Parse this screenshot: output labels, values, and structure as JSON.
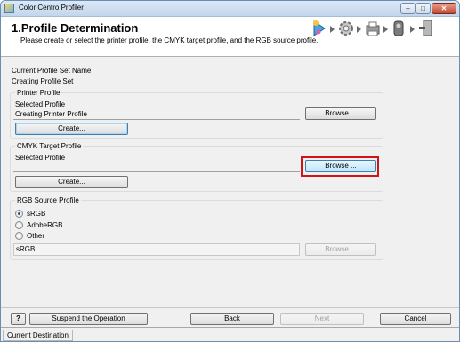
{
  "window": {
    "title": "Color Centro Profiler",
    "min_glyph": "–",
    "max_glyph": "□",
    "close_glyph": "✕"
  },
  "header": {
    "title": "1.Profile Determination",
    "description": "Please create or select the printer profile, the CMYK target profile, and the RGB source profile.",
    "steps": [
      "profile-step-icon",
      "gear-step-icon",
      "print-step-icon",
      "measure-step-icon",
      "finish-step-icon"
    ]
  },
  "profile_set": {
    "label": "Current Profile Set Name",
    "value": "Creating Profile Set"
  },
  "printer_profile": {
    "group_title": "Printer Profile",
    "selected_label": "Selected Profile",
    "selected_value": "Creating Printer Profile",
    "browse_label": "Browse ...",
    "create_label": "Create..."
  },
  "cmyk_profile": {
    "group_title": "CMYK Target Profile",
    "selected_label": "Selected Profile",
    "selected_value": "",
    "browse_label": "Browse ...",
    "create_label": "Create..."
  },
  "rgb_profile": {
    "group_title": "RGB Source Profile",
    "options": [
      "sRGB",
      "AdobeRGB",
      "Other"
    ],
    "selected_option": "sRGB",
    "value": "sRGB",
    "browse_label": "Browse ..."
  },
  "footer": {
    "help_glyph": "?",
    "suspend_label": "Suspend the Operation",
    "back_label": "Back",
    "next_label": "Next",
    "cancel_label": "Cancel"
  },
  "status": {
    "text": "Current Destination"
  }
}
